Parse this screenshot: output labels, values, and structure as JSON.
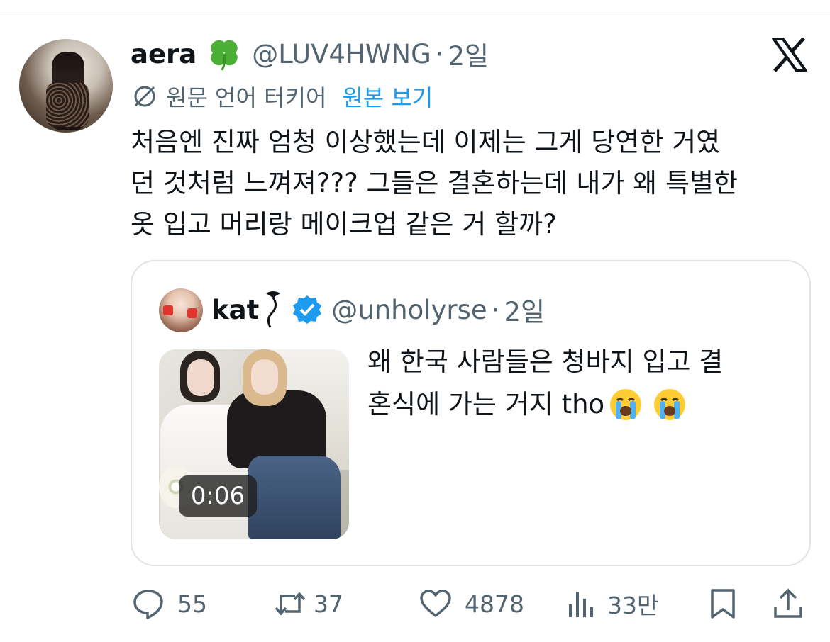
{
  "tweet": {
    "display_name": "aera",
    "display_name_emoji": "four-leaf-clover",
    "handle": "@LUV4HWNG",
    "separator": "·",
    "time": "2일",
    "translate_note": "원문 언어 터키어",
    "show_original_label": "원본 보기",
    "body_lines": [
      "처음엔 진짜 엄청 이상했는데 이제는 그게 당연한 거였",
      "던 것처럼 느껴져??? 그들은 결혼하는데 내가 왜 특별한",
      "옷 입고 머리랑 메이크업 같은 거 할까?"
    ]
  },
  "quote": {
    "display_name": "kat",
    "handle": "@unholyrse",
    "separator": "·",
    "time": "2일",
    "video_duration": "0:06",
    "text_line1": "왜 한국 사람들은 청바지 입고 결",
    "text_line2": "혼식에 가는 거지 tho",
    "text_emojis": [
      "loudly-crying-face",
      "loudly-crying-face"
    ]
  },
  "actions": {
    "replies": "55",
    "retweets": "37",
    "likes": "4878",
    "views": "33만"
  },
  "colors": {
    "text_primary": "#0f1419",
    "text_secondary": "#536471",
    "link_blue": "#1d9bf0",
    "border": "#dfe3e7"
  }
}
